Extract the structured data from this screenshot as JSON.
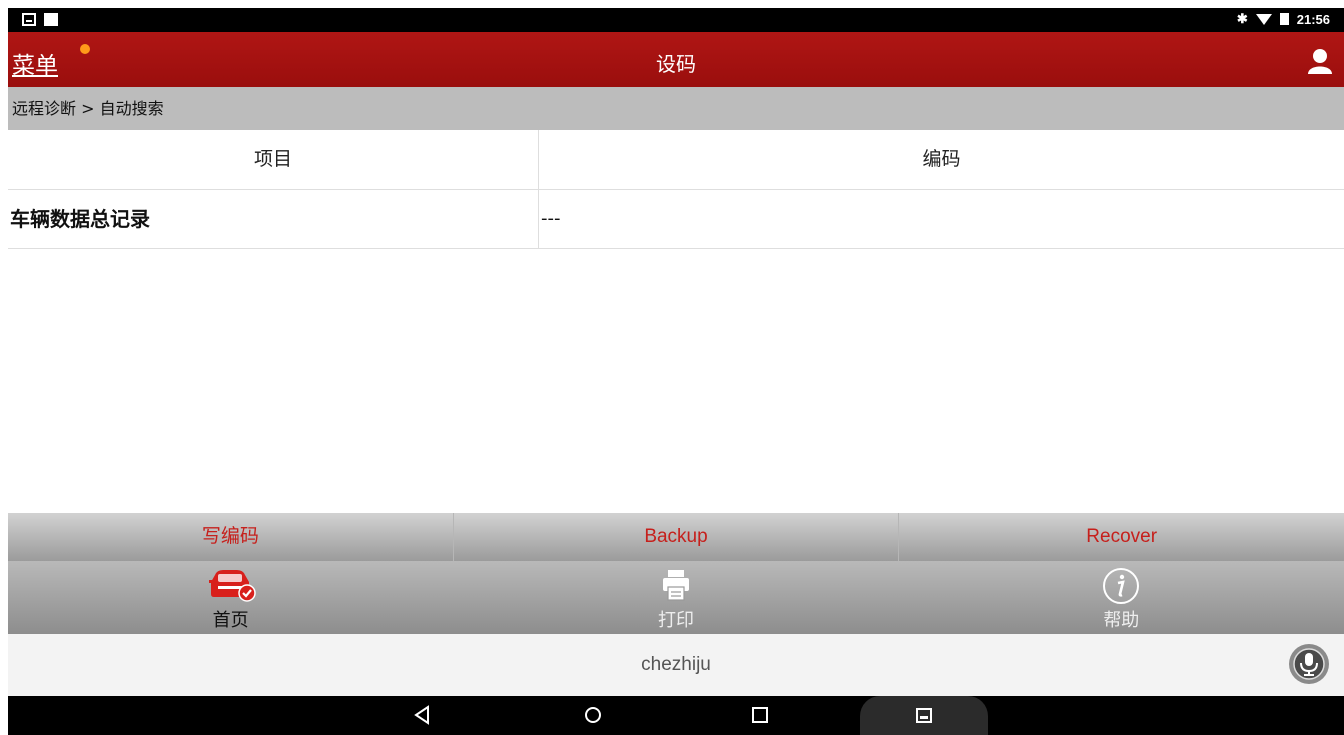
{
  "status_bar": {
    "time": "21:56",
    "bluetooth_glyph": "✱"
  },
  "header": {
    "menu_label": "菜单",
    "title": "设码",
    "accent_color": "#a51210"
  },
  "breadcrumb": {
    "text": "远程诊断 > 自动搜索"
  },
  "table": {
    "columns": [
      "项目",
      "编码"
    ],
    "rows": [
      {
        "item": "车辆数据总记录",
        "code": "---"
      }
    ]
  },
  "function_buttons": [
    "写编码",
    "Backup",
    "Recover"
  ],
  "nav": {
    "home": {
      "label": "首页",
      "icon": "car-icon"
    },
    "print": {
      "label": "打印",
      "icon": "printer-icon"
    },
    "help": {
      "label": "帮助",
      "icon": "info-icon"
    }
  },
  "footer": {
    "text": "chezhiju",
    "icon": "microphone-icon"
  }
}
